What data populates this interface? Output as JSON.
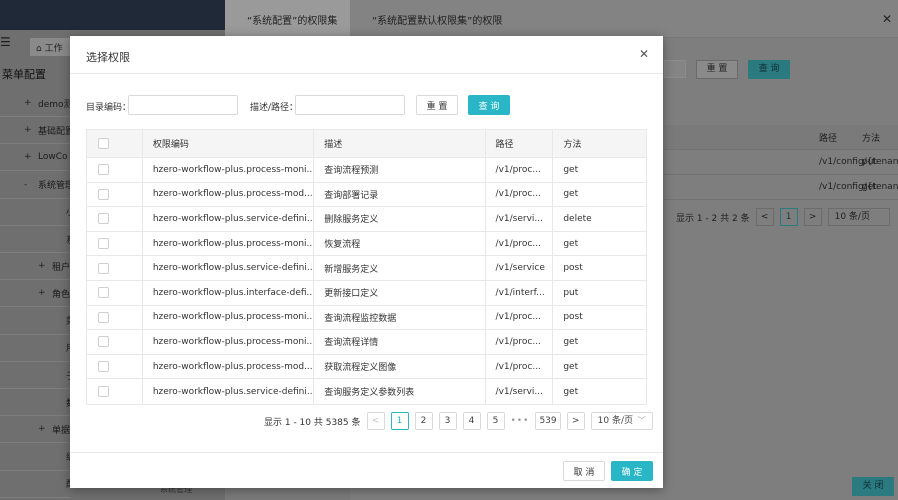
{
  "background": {
    "nav_tab": "工作",
    "nav_title": "菜单配置",
    "tree": [
      {
        "pm": "+",
        "label": "demo测"
      },
      {
        "pm": "+",
        "label": "基础配置"
      },
      {
        "pm": "+",
        "label": "LowCo"
      },
      {
        "pm": "-",
        "label": "系统管理"
      },
      {
        "pm": "",
        "label": "小"
      },
      {
        "pm": "",
        "label": "系统"
      },
      {
        "pm": "+",
        "label": "租户"
      },
      {
        "pm": "+",
        "label": "角色"
      },
      {
        "pm": "",
        "label": "菜单"
      },
      {
        "pm": "",
        "label": "用户"
      },
      {
        "pm": "",
        "label": "子账"
      },
      {
        "pm": "",
        "label": "数据"
      },
      {
        "pm": "+",
        "label": "单据"
      },
      {
        "pm": "",
        "label": "编码"
      },
      {
        "pm": "",
        "label": "配置"
      }
    ],
    "mid_header": "“系统配置”的权限集",
    "mid_bottom": "系统管理",
    "right_header": "“系统配置默认权限集”的权限",
    "right_reset": "重 置",
    "right_query": "查 询",
    "right_table": {
      "head": [
        "",
        "路径",
        "方法"
      ],
      "rows": [
        [
          "",
          "/v1/config/{tenant...",
          "put"
        ],
        [
          "",
          "/v1/config/{tenant...",
          "get"
        ]
      ]
    },
    "right_pager_total": "显示 1 - 2 共 2 条",
    "right_pager_page": "1",
    "right_pager_size": "10 条/页",
    "right_close": "关 闭"
  },
  "modal": {
    "title": "选择权限",
    "search": {
      "code_label": "目录编码：",
      "code_value": "",
      "desc_label": "描述/路径：",
      "desc_value": "",
      "reset": "重 置",
      "query": "查 询"
    },
    "table": {
      "headers": [
        "权限编码",
        "描述",
        "路径",
        "方法"
      ],
      "rows": [
        {
          "code": "hzero-workflow-plus.process-moni...",
          "desc": "查询流程预测",
          "path": "/v1/proc...",
          "method": "get"
        },
        {
          "code": "hzero-workflow-plus.process-mod...",
          "desc": "查询部署记录",
          "path": "/v1/proc...",
          "method": "get"
        },
        {
          "code": "hzero-workflow-plus.service-defini...",
          "desc": "删除服务定义",
          "path": "/v1/servi...",
          "method": "delete"
        },
        {
          "code": "hzero-workflow-plus.process-moni...",
          "desc": "恢复流程",
          "path": "/v1/proc...",
          "method": "get"
        },
        {
          "code": "hzero-workflow-plus.service-defini...",
          "desc": "新增服务定义",
          "path": "/v1/service",
          "method": "post"
        },
        {
          "code": "hzero-workflow-plus.interface-defi...",
          "desc": "更新接口定义",
          "path": "/v1/interf...",
          "method": "put"
        },
        {
          "code": "hzero-workflow-plus.process-moni...",
          "desc": "查询流程监控数据",
          "path": "/v1/proc...",
          "method": "post"
        },
        {
          "code": "hzero-workflow-plus.process-moni...",
          "desc": "查询流程详情",
          "path": "/v1/proc...",
          "method": "get"
        },
        {
          "code": "hzero-workflow-plus.process-mod...",
          "desc": "获取流程定义图像",
          "path": "/v1/proc...",
          "method": "get"
        },
        {
          "code": "hzero-workflow-plus.service-defini...",
          "desc": "查询服务定义参数列表",
          "path": "/v1/servi...",
          "method": "get"
        }
      ]
    },
    "pager": {
      "total": "显示 1 - 10 共 5385 条",
      "prev": "<",
      "pages": [
        "1",
        "2",
        "3",
        "4",
        "5"
      ],
      "dots": "•••",
      "last": "539",
      "next": ">",
      "size": "10 条/页"
    },
    "footer": {
      "cancel": "取 消",
      "ok": "确 定"
    }
  },
  "colors": {
    "primary": "#29b6c6",
    "border": "#e8e8e8",
    "header_bg": "#f5f5f5"
  }
}
